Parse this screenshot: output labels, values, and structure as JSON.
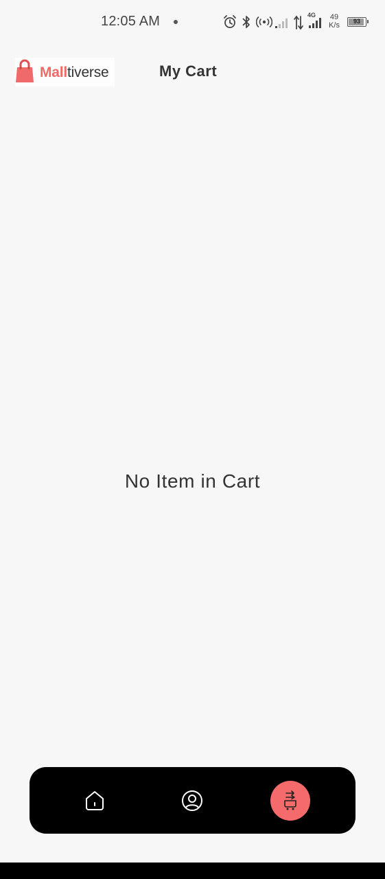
{
  "status_bar": {
    "time": "12:05 AM",
    "network_label": "4G",
    "speed_value": "49",
    "speed_unit": "K/s",
    "battery_level": "93",
    "battery_fraction": 0.93,
    "icons": [
      "alarm-icon",
      "bluetooth-icon",
      "hotspot-icon",
      "signal-weak-icon",
      "data-transfer-icon",
      "signal-4g-icon",
      "battery-icon"
    ]
  },
  "header": {
    "logo_brand_part1": "Mall",
    "logo_brand_part2": "tiverse",
    "title": "My Cart"
  },
  "cart": {
    "empty_message": "No Item in Cart"
  },
  "bottom_nav": {
    "items": [
      {
        "name": "home",
        "icon": "home-icon",
        "active": false
      },
      {
        "name": "profile",
        "icon": "user-circle-icon",
        "active": false
      },
      {
        "name": "cart",
        "icon": "cart-icon",
        "active": true
      }
    ],
    "active_color": "#f56b6b"
  },
  "colors": {
    "background": "#f7f7f7",
    "brand": "#f06a6a",
    "nav_background": "#000000",
    "text": "#333333"
  }
}
